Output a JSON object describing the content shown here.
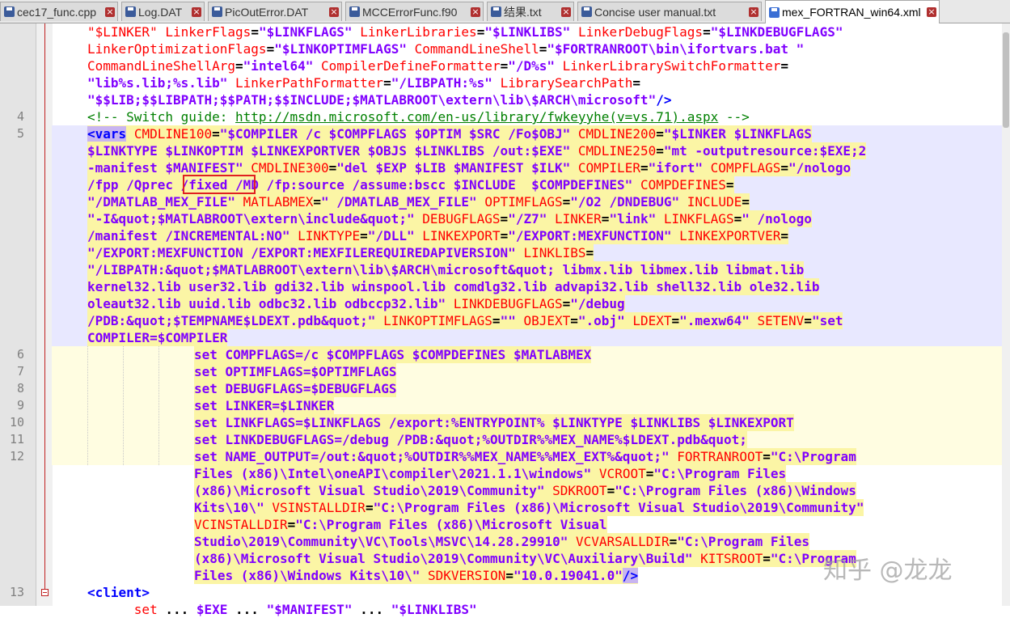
{
  "tabs": [
    {
      "label": "cec17_func.cpp",
      "active": false
    },
    {
      "label": "Log.DAT",
      "active": false
    },
    {
      "label": "PicOutError.DAT",
      "active": false
    },
    {
      "label": "MCCErrorFunc.f90",
      "active": false
    },
    {
      "label": "结果.txt",
      "active": false
    },
    {
      "label": "Concise user manual.txt",
      "active": false
    },
    {
      "label": "mex_FORTRAN_win64.xml",
      "active": true
    }
  ],
  "line_numbers": {
    "l4": "4",
    "l5": "5",
    "l6": "6",
    "l7": "7",
    "l8": "8",
    "l9": "9",
    "l10": "10",
    "l11": "11",
    "l12": "12",
    "l13": "13"
  },
  "code": {
    "r1": [
      [
        "a",
        "\"$LINKER\""
      ],
      [
        "p",
        " "
      ],
      [
        "a",
        "LinkerFlags"
      ],
      [
        "p",
        "="
      ],
      [
        "v",
        "\"$LINKFLAGS\""
      ],
      [
        "p",
        " "
      ],
      [
        "a",
        "LinkerLibraries"
      ],
      [
        "p",
        "="
      ],
      [
        "v",
        "\"$LINKLIBS\""
      ],
      [
        "p",
        " "
      ],
      [
        "a",
        "LinkerDebugFlags"
      ],
      [
        "p",
        "="
      ],
      [
        "v",
        "\"$LINKDEBUGFLAGS\""
      ]
    ],
    "r2": [
      [
        "a",
        "LinkerOptimizationFlags"
      ],
      [
        "p",
        "="
      ],
      [
        "v",
        "\"$LINKOPTIMFLAGS\""
      ],
      [
        "p",
        " "
      ],
      [
        "a",
        "CommandLineShell"
      ],
      [
        "p",
        "="
      ],
      [
        "v",
        "\"$FORTRANROOT\\bin\\ifortvars.bat \""
      ]
    ],
    "r3": [
      [
        "a",
        "CommandLineShellArg"
      ],
      [
        "p",
        "="
      ],
      [
        "v",
        "\"intel64\""
      ],
      [
        "p",
        " "
      ],
      [
        "a",
        "CompilerDefineFormatter"
      ],
      [
        "p",
        "="
      ],
      [
        "v",
        "\"/D%s\""
      ],
      [
        "p",
        " "
      ],
      [
        "a",
        "LinkerLibrarySwitchFormatter"
      ],
      [
        "p",
        "="
      ]
    ],
    "r4": [
      [
        "v",
        "\"lib%s.lib;%s.lib\""
      ],
      [
        "p",
        " "
      ],
      [
        "a",
        "LinkerPathFormatter"
      ],
      [
        "p",
        "="
      ],
      [
        "v",
        "\"/LIBPATH:%s\""
      ],
      [
        "p",
        " "
      ],
      [
        "a",
        "LibrarySearchPath"
      ],
      [
        "p",
        "="
      ]
    ],
    "r5": [
      [
        "v",
        "\"$$LIB;$$LIBPATH;$$PATH;$$INCLUDE;$MATLABROOT\\extern\\lib\\$ARCH\\microsoft\""
      ],
      [
        "tg",
        "/>"
      ]
    ],
    "r6": [
      [
        "c",
        "<!-- Switch guide: "
      ],
      [
        "u",
        "http://msdn.microsoft.com/en-us/library/fwkeyyhe(v=vs.71).aspx"
      ],
      [
        "c",
        " -->"
      ]
    ],
    "r7": [
      [
        "tagh",
        "<vars"
      ],
      [
        "p",
        " "
      ],
      [
        "a",
        "CMDLINE100"
      ],
      [
        "p",
        "="
      ],
      [
        "v",
        "\"$COMPILER /c $COMPFLAGS $OPTIM $SRC /Fo$OBJ\""
      ],
      [
        "p",
        " "
      ],
      [
        "a",
        "CMDLINE200"
      ],
      [
        "p",
        "="
      ],
      [
        "v",
        "\"$LINKER $LINKFLAGS"
      ]
    ],
    "r8": [
      [
        "v",
        "$LINKTYPE $LINKOPTIM $LINKEXPORTVER $OBJS $LINKLIBS /out:$EXE\""
      ],
      [
        "p",
        " "
      ],
      [
        "a",
        "CMDLINE250"
      ],
      [
        "p",
        "="
      ],
      [
        "v",
        "\"mt -outputresource:$EXE;2"
      ]
    ],
    "r9": [
      [
        "v",
        "-manifest $MANIFEST\""
      ],
      [
        "p",
        " "
      ],
      [
        "a",
        "CMDLINE300"
      ],
      [
        "p",
        "="
      ],
      [
        "v",
        "\"del $EXP $LIB $MANIFEST $ILK\""
      ],
      [
        "p",
        " "
      ],
      [
        "a",
        "COMPILER"
      ],
      [
        "p",
        "="
      ],
      [
        "v",
        "\"ifort\""
      ],
      [
        "p",
        " "
      ],
      [
        "a",
        "COMPFLAGS"
      ],
      [
        "p",
        "="
      ],
      [
        "v",
        "\"/nologo"
      ]
    ],
    "r10": [
      [
        "v",
        "/fpp /Qprec /fixed /MD /fp:source /assume:bscc $INCLUDE  $COMPDEFINES\""
      ],
      [
        "p",
        " "
      ],
      [
        "a",
        "COMPDEFINES"
      ],
      [
        "p",
        "="
      ]
    ],
    "r11": [
      [
        "v",
        "\"/DMATLAB_MEX_FILE\""
      ],
      [
        "p",
        " "
      ],
      [
        "a",
        "MATLABMEX"
      ],
      [
        "p",
        "="
      ],
      [
        "v",
        "\" /DMATLAB_MEX_FILE\""
      ],
      [
        "p",
        " "
      ],
      [
        "a",
        "OPTIMFLAGS"
      ],
      [
        "p",
        "="
      ],
      [
        "v",
        "\"/O2 /DNDEBUG\""
      ],
      [
        "p",
        " "
      ],
      [
        "a",
        "INCLUDE"
      ],
      [
        "p",
        "="
      ]
    ],
    "r12": [
      [
        "v",
        "\"-I&quot;$MATLABROOT\\extern\\include&quot;\""
      ],
      [
        "p",
        " "
      ],
      [
        "a",
        "DEBUGFLAGS"
      ],
      [
        "p",
        "="
      ],
      [
        "v",
        "\"/Z7\""
      ],
      [
        "p",
        " "
      ],
      [
        "a",
        "LINKER"
      ],
      [
        "p",
        "="
      ],
      [
        "v",
        "\"link\""
      ],
      [
        "p",
        " "
      ],
      [
        "a",
        "LINKFLAGS"
      ],
      [
        "p",
        "="
      ],
      [
        "v",
        "\" /nologo"
      ]
    ],
    "r13": [
      [
        "v",
        "/manifest /INCREMENTAL:NO\""
      ],
      [
        "p",
        " "
      ],
      [
        "a",
        "LINKTYPE"
      ],
      [
        "p",
        "="
      ],
      [
        "v",
        "\"/DLL\""
      ],
      [
        "p",
        " "
      ],
      [
        "a",
        "LINKEXPORT"
      ],
      [
        "p",
        "="
      ],
      [
        "v",
        "\"/EXPORT:MEXFUNCTION\""
      ],
      [
        "p",
        " "
      ],
      [
        "a",
        "LINKEXPORTVER"
      ],
      [
        "p",
        "="
      ]
    ],
    "r14": [
      [
        "v",
        "\"/EXPORT:MEXFUNCTION /EXPORT:MEXFILEREQUIREDAPIVERSION\""
      ],
      [
        "p",
        " "
      ],
      [
        "a",
        "LINKLIBS"
      ],
      [
        "p",
        "="
      ]
    ],
    "r15": [
      [
        "v",
        "\"/LIBPATH:&quot;$MATLABROOT\\extern\\lib\\$ARCH\\microsoft&quot; libmx.lib libmex.lib libmat.lib"
      ]
    ],
    "r16": [
      [
        "v",
        "kernel32.lib user32.lib gdi32.lib winspool.lib comdlg32.lib advapi32.lib shell32.lib ole32.lib"
      ]
    ],
    "r17": [
      [
        "v",
        "oleaut32.lib uuid.lib odbc32.lib odbccp32.lib\""
      ],
      [
        "p",
        " "
      ],
      [
        "a",
        "LINKDEBUGFLAGS"
      ],
      [
        "p",
        "="
      ],
      [
        "v",
        "\"/debug"
      ]
    ],
    "r18": [
      [
        "v",
        "/PDB:&quot;$TEMPNAME$LDEXT.pdb&quot;\""
      ],
      [
        "p",
        " "
      ],
      [
        "a",
        "LINKOPTIMFLAGS"
      ],
      [
        "p",
        "="
      ],
      [
        "v",
        "\"\""
      ],
      [
        "p",
        " "
      ],
      [
        "a",
        "OBJEXT"
      ],
      [
        "p",
        "="
      ],
      [
        "v",
        "\".obj\""
      ],
      [
        "p",
        " "
      ],
      [
        "a",
        "LDEXT"
      ],
      [
        "p",
        "="
      ],
      [
        "v",
        "\".mexw64\""
      ],
      [
        "p",
        " "
      ],
      [
        "a",
        "SETENV"
      ],
      [
        "p",
        "="
      ],
      [
        "v",
        "\"set"
      ]
    ],
    "r19": [
      [
        "v",
        "COMPILER=$COMPILER"
      ]
    ],
    "r20": [
      [
        "v",
        "set COMPFLAGS=/c $COMPFLAGS $COMPDEFINES $MATLABMEX"
      ]
    ],
    "r21": [
      [
        "v",
        "set OPTIMFLAGS=$OPTIMFLAGS"
      ]
    ],
    "r22": [
      [
        "v",
        "set DEBUGFLAGS=$DEBUGFLAGS"
      ]
    ],
    "r23": [
      [
        "v",
        "set LINKER=$LINKER"
      ]
    ],
    "r24": [
      [
        "v",
        "set LINKFLAGS=$LINKFLAGS /export:%ENTRYPOINT% $LINKTYPE $LINKLIBS $LINKEXPORT"
      ]
    ],
    "r25": [
      [
        "v",
        "set LINKDEBUGFLAGS=/debug /PDB:&quot;%OUTDIR%%MEX_NAME%$LDEXT.pdb&quot;"
      ]
    ],
    "r26": [
      [
        "v",
        "set NAME_OUTPUT=/out:&quot;%OUTDIR%%MEX_NAME%%MEX_EXT%&quot;\""
      ],
      [
        "p",
        " "
      ],
      [
        "a",
        "FORTRANROOT"
      ],
      [
        "p",
        "="
      ],
      [
        "v",
        "\"C:\\Program"
      ]
    ],
    "r27": [
      [
        "v",
        "Files (x86)\\Intel\\oneAPI\\compiler\\2021.1.1\\windows\""
      ],
      [
        "p",
        " "
      ],
      [
        "a",
        "VCROOT"
      ],
      [
        "p",
        "="
      ],
      [
        "v",
        "\"C:\\Program Files"
      ]
    ],
    "r28": [
      [
        "v",
        "(x86)\\Microsoft Visual Studio\\2019\\Community\""
      ],
      [
        "p",
        " "
      ],
      [
        "a",
        "SDKROOT"
      ],
      [
        "p",
        "="
      ],
      [
        "v",
        "\"C:\\Program Files (x86)\\Windows"
      ]
    ],
    "r29": [
      [
        "v",
        "Kits\\10\\\""
      ],
      [
        "p",
        " "
      ],
      [
        "a",
        "VSINSTALLDIR"
      ],
      [
        "p",
        "="
      ],
      [
        "v",
        "\"C:\\Program Files (x86)\\Microsoft Visual Studio\\2019\\Community\""
      ]
    ],
    "r30": [
      [
        "a",
        "VCINSTALLDIR"
      ],
      [
        "p",
        "="
      ],
      [
        "v",
        "\"C:\\Program Files (x86)\\Microsoft Visual"
      ]
    ],
    "r31": [
      [
        "v",
        "Studio\\2019\\Community\\VC\\Tools\\MSVC\\14.28.29910\""
      ],
      [
        "p",
        " "
      ],
      [
        "a",
        "VCVARSALLDIR"
      ],
      [
        "p",
        "="
      ],
      [
        "v",
        "\"C:\\Program Files"
      ]
    ],
    "r32": [
      [
        "v",
        "(x86)\\Microsoft Visual Studio\\2019\\Community\\VC\\Auxiliary\\Build\""
      ],
      [
        "p",
        " "
      ],
      [
        "a",
        "KITSROOT"
      ],
      [
        "p",
        "="
      ],
      [
        "v",
        "\"C:\\Program"
      ]
    ],
    "r33": [
      [
        "v",
        "Files (x86)\\Windows Kits\\10\\\""
      ],
      [
        "p",
        " "
      ],
      [
        "a",
        "SDKVERSION"
      ],
      [
        "p",
        "="
      ],
      [
        "v",
        "\"10.0.19041.0\""
      ],
      [
        "tagh",
        "/>"
      ]
    ],
    "r34": [
      [
        "tg",
        "<client>"
      ]
    ],
    "r35": [
      [
        "p",
        "      "
      ],
      [
        "a",
        "set"
      ],
      [
        "p",
        " ... "
      ],
      [
        "v",
        "$EXE"
      ],
      [
        "p",
        " ... "
      ],
      [
        "v",
        "\"$MANIFEST\""
      ],
      [
        "p",
        " ... "
      ],
      [
        "v",
        "\"$LINKLIBS\""
      ]
    ]
  },
  "watermark": "知乎 @龙龙"
}
